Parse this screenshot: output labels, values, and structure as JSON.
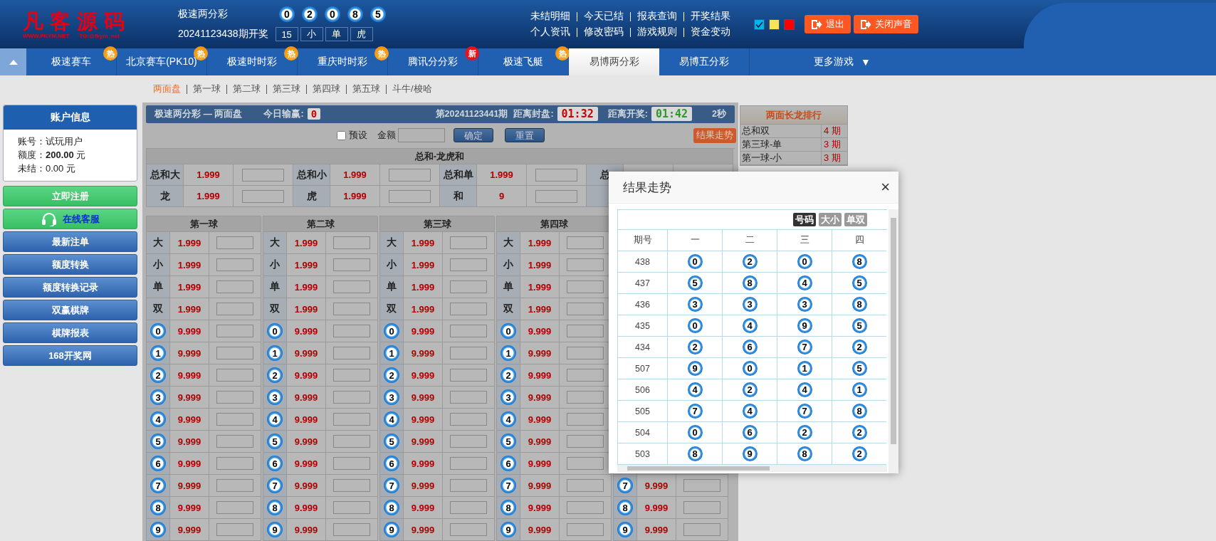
{
  "header": {
    "logo": {
      "title": "凡客源码",
      "site": "WWW.FKYM.NET",
      "contact": "TG:@fkym_net"
    },
    "lottery": "极速两分彩",
    "balls": [
      "0",
      "2",
      "0",
      "8",
      "5"
    ],
    "draw_label": "20241123438期开奖",
    "results": [
      "15",
      "小",
      "单",
      "虎"
    ],
    "links": [
      [
        "未结明细",
        "今天已结",
        "报表查询",
        "开奖结果"
      ],
      [
        "个人资讯",
        "修改密码",
        "游戏规则",
        "资金变动"
      ]
    ],
    "theme_swatches": [
      {
        "color": "#00b4f0",
        "selected": true
      },
      {
        "color": "#f8e557",
        "selected": false
      },
      {
        "color": "#ff0000",
        "selected": false
      }
    ],
    "buttons": [
      "退出",
      "关闭声音"
    ]
  },
  "nav": {
    "tabs": [
      {
        "label": "极速赛车",
        "selected": false,
        "badge": {
          "text": "热",
          "kind": "hot"
        }
      },
      {
        "label": "北京赛车(PK10)",
        "selected": false,
        "badge": {
          "text": "热",
          "kind": "hot"
        }
      },
      {
        "label": "极速时时彩",
        "selected": false,
        "badge": {
          "text": "热",
          "kind": "hot"
        }
      },
      {
        "label": "重庆时时彩",
        "selected": false,
        "badge": {
          "text": "热",
          "kind": "hot"
        }
      },
      {
        "label": "腾讯分分彩",
        "selected": false,
        "badge": {
          "text": "新",
          "kind": "new"
        }
      },
      {
        "label": "极速飞艇",
        "selected": false,
        "badge": {
          "text": "热",
          "kind": "hot"
        }
      },
      {
        "label": "易博两分彩",
        "selected": true
      },
      {
        "label": "易博五分彩",
        "selected": false
      }
    ],
    "more": {
      "label": "更多游戏",
      "caret": "▼"
    }
  },
  "subnav": [
    {
      "label": "两面盘",
      "selected": true
    },
    {
      "label": "第一球",
      "selected": false
    },
    {
      "label": "第二球",
      "selected": false
    },
    {
      "label": "第三球",
      "selected": false
    },
    {
      "label": "第四球",
      "selected": false
    },
    {
      "label": "第五球",
      "selected": false
    },
    {
      "label": "斗牛/梭哈",
      "selected": false
    }
  ],
  "sidebar": {
    "account": {
      "title": "账户信息",
      "lines": [
        "账号：试玩用户",
        "额度：**200.00** 元",
        "未结：0.00 元"
      ]
    },
    "buttons": [
      {
        "label": "立即注册",
        "kind": "green"
      },
      {
        "label": "在线客服",
        "kind": "service"
      },
      {
        "label": "最新注单",
        "kind": "blue"
      },
      {
        "label": "额度转换",
        "kind": "blue"
      },
      {
        "label": "额度转换记录",
        "kind": "blue"
      },
      {
        "label": "双赢棋牌",
        "kind": "blue"
      },
      {
        "label": "棋牌报表",
        "kind": "blue"
      },
      {
        "label": "168开奖网",
        "kind": "blue"
      }
    ]
  },
  "info_bar": {
    "title": "极速两分彩 — 两面盘",
    "profit_label": "今日输赢:",
    "profit": "0",
    "period": "第20241123441期",
    "close_label": "距离封盘:",
    "close_time": "01:32",
    "draw_label": "距离开奖:",
    "draw_time": "01:42",
    "refresh": "2秒"
  },
  "controls": {
    "preset": {
      "label": "预设",
      "checked": false
    },
    "amount_label": "金额",
    "confirm": "确定",
    "reset": "重置",
    "trend": "结果走势"
  },
  "sum_table": {
    "title": "总和-龙虎和",
    "rows": [
      [
        {
          "name": "总和大",
          "odds": "1.999"
        },
        {
          "name": "总和小",
          "odds": "1.999"
        },
        {
          "name": "总和单",
          "odds": "1.999"
        },
        {
          "name": "总"
        }
      ],
      [
        {
          "name": "龙",
          "odds": "1.999"
        },
        {
          "name": "虎",
          "odds": "1.999"
        },
        {
          "name": "和",
          "odds": "9"
        }
      ]
    ]
  },
  "ball_columns": [
    {
      "title": "第一球",
      "rows": [
        {
          "kind": "text",
          "label": "大",
          "odds": "1.999"
        },
        {
          "kind": "text",
          "label": "小",
          "odds": "1.999"
        },
        {
          "kind": "text",
          "label": "单",
          "odds": "1.999"
        },
        {
          "kind": "text",
          "label": "双",
          "odds": "1.999"
        },
        {
          "kind": "ball",
          "label": "0",
          "odds": "9.999"
        },
        {
          "kind": "ball",
          "label": "1",
          "odds": "9.999"
        },
        {
          "kind": "ball",
          "label": "2",
          "odds": "9.999"
        },
        {
          "kind": "ball",
          "label": "3",
          "odds": "9.999"
        },
        {
          "kind": "ball",
          "label": "4",
          "odds": "9.999"
        },
        {
          "kind": "ball",
          "label": "5",
          "odds": "9.999"
        },
        {
          "kind": "ball",
          "label": "6",
          "odds": "9.999"
        },
        {
          "kind": "ball",
          "label": "7",
          "odds": "9.999"
        },
        {
          "kind": "ball",
          "label": "8",
          "odds": "9.999"
        },
        {
          "kind": "ball",
          "label": "9",
          "odds": "9.999"
        }
      ]
    },
    {
      "title": "第二球",
      "rows": [
        {
          "kind": "text",
          "label": "大",
          "odds": "1.999"
        },
        {
          "kind": "text",
          "label": "小",
          "odds": "1.999"
        },
        {
          "kind": "text",
          "label": "单",
          "odds": "1.999"
        },
        {
          "kind": "text",
          "label": "双",
          "odds": "1.999"
        },
        {
          "kind": "ball",
          "label": "0",
          "odds": "9.999"
        },
        {
          "kind": "ball",
          "label": "1",
          "odds": "9.999"
        },
        {
          "kind": "ball",
          "label": "2",
          "odds": "9.999"
        },
        {
          "kind": "ball",
          "label": "3",
          "odds": "9.999"
        },
        {
          "kind": "ball",
          "label": "4",
          "odds": "9.999"
        },
        {
          "kind": "ball",
          "label": "5",
          "odds": "9.999"
        },
        {
          "kind": "ball",
          "label": "6",
          "odds": "9.999"
        },
        {
          "kind": "ball",
          "label": "7",
          "odds": "9.999"
        },
        {
          "kind": "ball",
          "label": "8",
          "odds": "9.999"
        },
        {
          "kind": "ball",
          "label": "9",
          "odds": "9.999"
        }
      ]
    },
    {
      "title": "第三球",
      "rows": [
        {
          "kind": "text",
          "label": "大",
          "odds": "1.999"
        },
        {
          "kind": "text",
          "label": "小",
          "odds": "1.999"
        },
        {
          "kind": "text",
          "label": "单",
          "odds": "1.999"
        },
        {
          "kind": "text",
          "label": "双",
          "odds": "1.999"
        },
        {
          "kind": "ball",
          "label": "0",
          "odds": "9.999"
        },
        {
          "kind": "ball",
          "label": "1",
          "odds": "9.999"
        },
        {
          "kind": "ball",
          "label": "2",
          "odds": "9.999"
        },
        {
          "kind": "ball",
          "label": "3",
          "odds": "9.999"
        },
        {
          "kind": "ball",
          "label": "4",
          "odds": "9.999"
        },
        {
          "kind": "ball",
          "label": "5",
          "odds": "9.999"
        },
        {
          "kind": "ball",
          "label": "6",
          "odds": "9.999"
        },
        {
          "kind": "ball",
          "label": "7",
          "odds": "9.999"
        },
        {
          "kind": "ball",
          "label": "8",
          "odds": "9.999"
        },
        {
          "kind": "ball",
          "label": "9",
          "odds": "9.999"
        }
      ]
    },
    {
      "title": "第四球",
      "rows": [
        {
          "kind": "text",
          "label": "大",
          "odds": "1.999"
        },
        {
          "kind": "text",
          "label": "小",
          "odds": "1.999"
        },
        {
          "kind": "text",
          "label": "单",
          "odds": "1.999"
        },
        {
          "kind": "text",
          "label": "双",
          "odds": "1.999"
        },
        {
          "kind": "ball",
          "label": "0",
          "odds": "9.999"
        },
        {
          "kind": "ball",
          "label": "1",
          "odds": "9.999"
        },
        {
          "kind": "ball",
          "label": "2",
          "odds": "9.999"
        },
        {
          "kind": "ball",
          "label": "3",
          "odds": "9.999"
        },
        {
          "kind": "ball",
          "label": "4",
          "odds": "9.999"
        },
        {
          "kind": "ball",
          "label": "5",
          "odds": "9.999"
        },
        {
          "kind": "ball",
          "label": "6",
          "odds": "9.999"
        },
        {
          "kind": "ball",
          "label": "7",
          "odds": "9.999"
        },
        {
          "kind": "ball",
          "label": "8",
          "odds": "9.999"
        },
        {
          "kind": "ball",
          "label": "9",
          "odds": "9.999"
        }
      ]
    },
    {
      "rows": [
        {
          "kind": "ball",
          "label": "7",
          "odds": "9.999"
        },
        {
          "kind": "ball",
          "label": "8",
          "odds": "9.999"
        },
        {
          "kind": "ball",
          "label": "9",
          "odds": "9.999"
        }
      ]
    }
  ],
  "ranking": {
    "title": "两面长龙排行",
    "rows": [
      {
        "name": "总和双",
        "count": "4 期"
      },
      {
        "name": "第三球-单",
        "count": "3 期"
      },
      {
        "name": "第一球-小",
        "count": "3 期"
      }
    ]
  },
  "trend_modal": {
    "title": "结果走势",
    "close": "×",
    "tabs": [
      {
        "label": "号码",
        "selected": true
      },
      {
        "label": "大小",
        "selected": false
      },
      {
        "label": "单双",
        "selected": false
      }
    ],
    "columns": [
      "期号",
      "一",
      "二",
      "三",
      "四"
    ],
    "rows": [
      {
        "period": "438",
        "balls": [
          "0",
          "2",
          "0",
          "8"
        ]
      },
      {
        "period": "437",
        "balls": [
          "5",
          "8",
          "4",
          "5"
        ]
      },
      {
        "period": "436",
        "balls": [
          "3",
          "3",
          "3",
          "8"
        ]
      },
      {
        "period": "435",
        "balls": [
          "0",
          "4",
          "9",
          "5"
        ]
      },
      {
        "period": "434",
        "balls": [
          "2",
          "6",
          "7",
          "2"
        ]
      },
      {
        "period": "507",
        "balls": [
          "9",
          "0",
          "1",
          "5"
        ]
      },
      {
        "period": "506",
        "balls": [
          "4",
          "2",
          "4",
          "1"
        ]
      },
      {
        "period": "505",
        "balls": [
          "7",
          "4",
          "7",
          "8"
        ]
      },
      {
        "period": "504",
        "balls": [
          "0",
          "6",
          "2",
          "2"
        ]
      },
      {
        "period": "503",
        "balls": [
          "8",
          "9",
          "8",
          "2"
        ]
      }
    ]
  }
}
